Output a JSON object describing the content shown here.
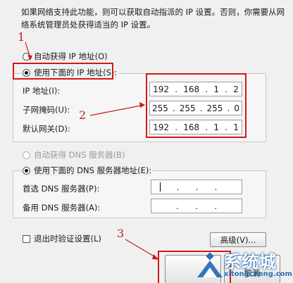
{
  "intro_text": "如果网络支持此功能，则可以获取自动指派的 IP 设置。否则，你需要从网络系统管理员处获得适当的 IP 设置。",
  "ip_section": {
    "auto_label": "自动获得 IP 地址(O)",
    "manual_label": "使用下面的 IP 地址(S):",
    "fields": [
      {
        "label": "IP 地址(I):",
        "octets": [
          "192",
          "168",
          "1",
          "2"
        ]
      },
      {
        "label": "子网掩码(U):",
        "octets": [
          "255",
          "255",
          "255",
          "0"
        ]
      },
      {
        "label": "默认网关(D):",
        "octets": [
          "192",
          "168",
          "1",
          "1"
        ]
      }
    ]
  },
  "dns_section": {
    "auto_label": "自动获得 DNS 服务器(B)",
    "manual_label": "使用下面的 DNS 服务器地址(E):",
    "preferred_label": "首选 DNS 服务器(P):",
    "alternate_label": "备用 DNS 服务器(A):"
  },
  "validate_label": "退出时验证设置(L)",
  "advanced_label": "高级(V)...",
  "cancel_label": "取消",
  "annotations": [
    "1",
    "2",
    "3"
  ],
  "watermark": {
    "brand": "系统城",
    "url": "xitongcheng.com"
  },
  "colors": {
    "annotation_red": "#d21818",
    "brand_blue": "#2a6fb5"
  }
}
